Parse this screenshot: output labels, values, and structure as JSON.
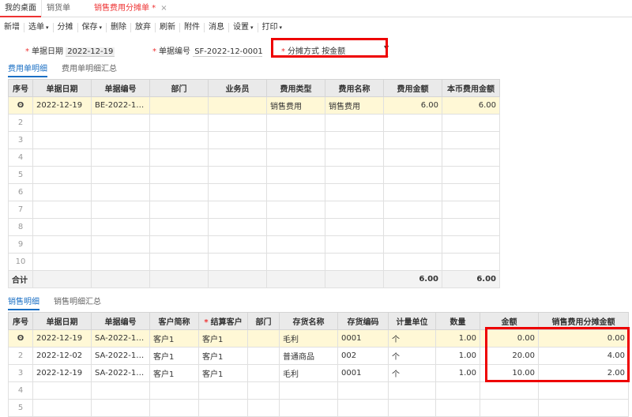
{
  "tabs": [
    {
      "label": "我的桌面"
    },
    {
      "label": "销货单"
    },
    {
      "label": "销售费用分摊单 *",
      "close": "×"
    }
  ],
  "toolbar": [
    {
      "label": "新增"
    },
    {
      "label": "选单",
      "caret": "▾"
    },
    {
      "label": "分摊"
    },
    {
      "label": "保存",
      "caret": "▾"
    },
    {
      "label": "删除"
    },
    {
      "label": "放弃"
    },
    {
      "label": "刷新"
    },
    {
      "label": "附件"
    },
    {
      "label": "消息"
    },
    {
      "label": "设置",
      "caret": "▾"
    },
    {
      "label": "打印",
      "caret": "▾"
    }
  ],
  "form": {
    "date_label": "单据日期",
    "date_value": "2022-12-19",
    "number_label": "单据编号",
    "number_value": "SF-2022-12-0001",
    "method_label": "分摊方式",
    "method_value": "按金额",
    "required_mark": "*"
  },
  "expense_tabs": [
    "费用单明细",
    "费用单明细汇总"
  ],
  "expense_table": {
    "headers": [
      "序号",
      "单据日期",
      "单据编号",
      "部门",
      "业务员",
      "费用类型",
      "费用名称",
      "费用金额",
      "本币费用金额"
    ],
    "rows": [
      [
        "ʘ",
        "2022-12-19",
        "BE-2022-12-...",
        "",
        "",
        "销售费用",
        "销售费用",
        "6.00",
        "6.00"
      ],
      [
        "2",
        "",
        "",
        "",
        "",
        "",
        "",
        "",
        ""
      ],
      [
        "3",
        "",
        "",
        "",
        "",
        "",
        "",
        "",
        ""
      ],
      [
        "4",
        "",
        "",
        "",
        "",
        "",
        "",
        "",
        ""
      ],
      [
        "5",
        "",
        "",
        "",
        "",
        "",
        "",
        "",
        ""
      ],
      [
        "6",
        "",
        "",
        "",
        "",
        "",
        "",
        "",
        ""
      ],
      [
        "7",
        "",
        "",
        "",
        "",
        "",
        "",
        "",
        ""
      ],
      [
        "8",
        "",
        "",
        "",
        "",
        "",
        "",
        "",
        ""
      ],
      [
        "9",
        "",
        "",
        "",
        "",
        "",
        "",
        "",
        ""
      ],
      [
        "10",
        "",
        "",
        "",
        "",
        "",
        "",
        "",
        ""
      ]
    ],
    "sum_row": [
      "合计",
      "",
      "",
      "",
      "",
      "",
      "",
      "6.00",
      "6.00"
    ]
  },
  "sales_tabs": [
    "销售明细",
    "销售明细汇总"
  ],
  "sales_table": {
    "headers": [
      "序号",
      "单据日期",
      "单据编号",
      "客户简称",
      "结算客户",
      "部门",
      "存货名称",
      "存货编码",
      "计量单位",
      "数量",
      "金额",
      "销售费用分摊金额"
    ],
    "required_header_index": 4,
    "rows": [
      [
        "ʘ",
        "2022-12-19",
        "SA-2022-12-...",
        "客户1",
        "客户1",
        "",
        "毛利",
        "0001",
        "个",
        "1.00",
        "0.00",
        "0.00"
      ],
      [
        "2",
        "2022-12-02",
        "SA-2022-12-...",
        "客户1",
        "客户1",
        "",
        "普通商品",
        "002",
        "个",
        "1.00",
        "20.00",
        "4.00"
      ],
      [
        "3",
        "2022-12-19",
        "SA-2022-12-...",
        "客户1",
        "客户1",
        "",
        "毛利",
        "0001",
        "个",
        "1.00",
        "10.00",
        "2.00"
      ],
      [
        "4",
        "",
        "",
        "",
        "",
        "",
        "",
        "",
        "",
        "",
        "",
        ""
      ],
      [
        "5",
        "",
        "",
        "",
        "",
        "",
        "",
        "",
        "",
        "",
        "",
        ""
      ]
    ]
  },
  "colors": {
    "accent": "#e33333",
    "highlight_box": "#e00000",
    "selected_row": "#fff8d6",
    "link": "#1a6fc4"
  }
}
